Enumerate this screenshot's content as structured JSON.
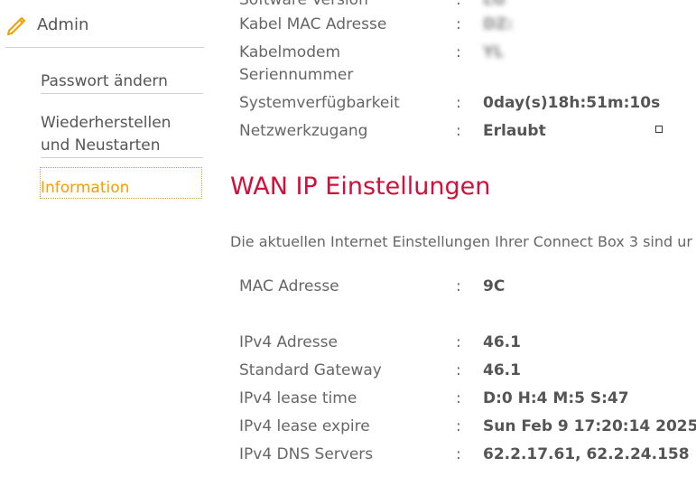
{
  "sidebar": {
    "admin_title": "Admin",
    "items": [
      {
        "label": "Passwort ändern"
      },
      {
        "label": "Wiederherstellen und Neustarten"
      },
      {
        "label": "Information"
      }
    ]
  },
  "status": {
    "rows": [
      {
        "label": "Software Version",
        "sep": ":",
        "value": "LG"
      },
      {
        "label": "Kabel MAC Adresse",
        "sep": ":",
        "value": "DZ:"
      },
      {
        "label": "Kabelmodem Seriennummer",
        "sep": ":",
        "value": "YL"
      },
      {
        "label": "Systemverfügbarkeit",
        "sep": ":",
        "value": "0day(s)18h:51m:10s"
      },
      {
        "label": "Netzwerkzugang",
        "sep": ":",
        "value": "Erlaubt"
      }
    ]
  },
  "wan": {
    "title": "WAN IP Einstellungen",
    "description": "Die aktuellen Internet Einstellungen Ihrer Connect Box 3 sind ur",
    "rows": [
      {
        "label": "MAC Adresse",
        "sep": ":",
        "value": "9C"
      },
      {
        "label": "IPv4 Adresse",
        "sep": ":",
        "value": "46.1"
      },
      {
        "label": "Standard Gateway",
        "sep": ":",
        "value": "46.1"
      },
      {
        "label": "IPv4 lease time",
        "sep": ":",
        "value": "D:0 H:4 M:5 S:47"
      },
      {
        "label": "IPv4 lease expire",
        "sep": ":",
        "value": "Sun Feb 9 17:20:14 2025"
      },
      {
        "label": "IPv4 DNS Servers",
        "sep": ":",
        "value": "62.2.17.61, 62.2.24.158"
      }
    ]
  },
  "colors": {
    "accent_title": "#d0103a",
    "active_nav": "#f0a000",
    "pencil_icon": "#f0a000"
  }
}
